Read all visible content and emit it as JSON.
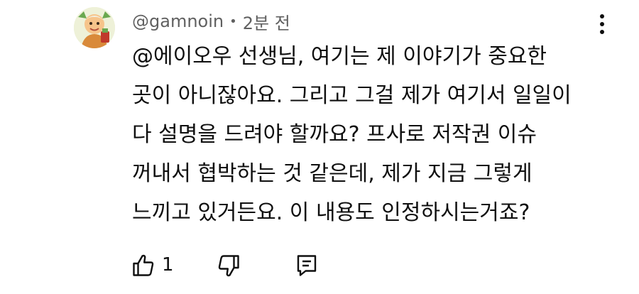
{
  "comment": {
    "author": "@gamnoin",
    "separator": "•",
    "time": "2분 전",
    "lines": [
      "@에이오우 선생님, 여기는 제 이야기가 중요한",
      "곳이 아니잖아요. 그리고 그걸 제가 여기서 일일이",
      "다 설명을 드려야 할까요? 프사로 저작권 이슈",
      "꺼내서 협박하는 것 같은데, 제가 지금 그렇게",
      "느끼고 있거든요. 이 내용도 인정하시는거죠?"
    ],
    "like_count": "1"
  },
  "icons": {
    "avatar": "cartoon-avatar",
    "more": "more-vertical-icon",
    "like": "thumbs-up-icon",
    "dislike": "thumbs-down-icon",
    "reply": "reply-comment-icon"
  },
  "colors": {
    "text": "#0f0f0f",
    "meta": "#606060",
    "background": "#ffffff"
  }
}
